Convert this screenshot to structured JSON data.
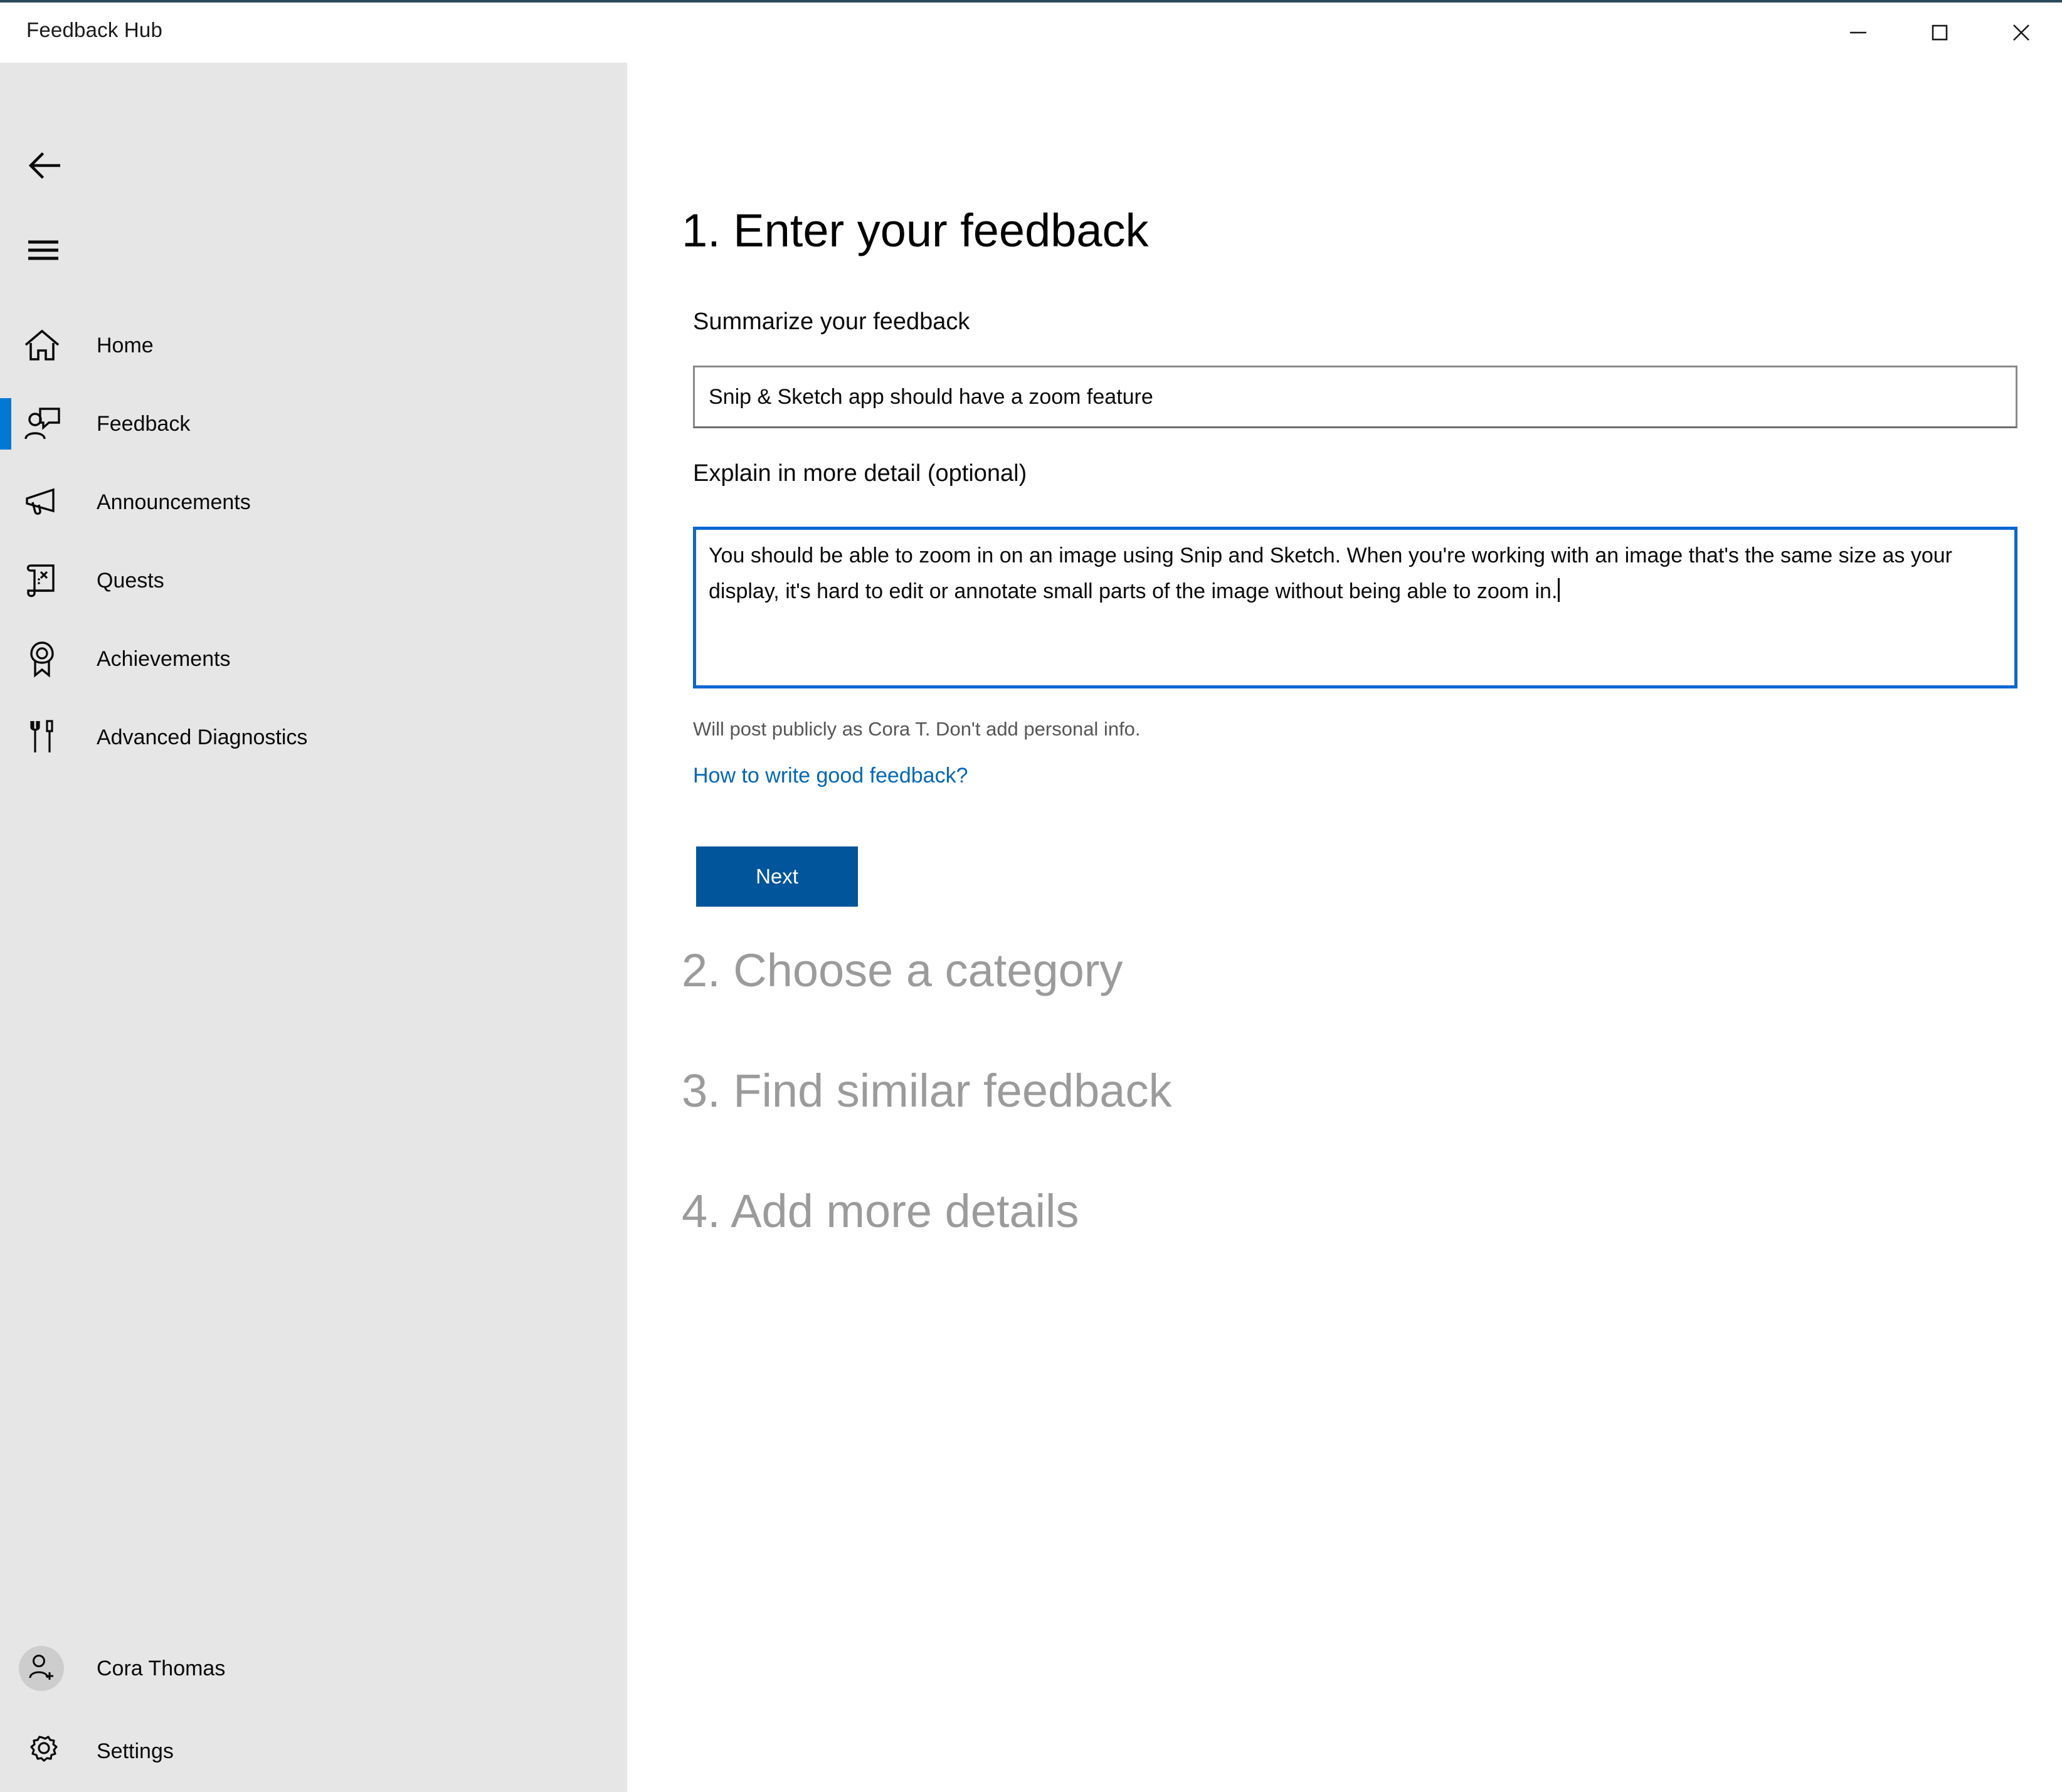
{
  "window": {
    "title": "Feedback Hub",
    "caption_buttons": [
      {
        "name": "minimize",
        "label": "Minimize"
      },
      {
        "name": "maximize",
        "label": "Maximize"
      },
      {
        "name": "close",
        "label": "Close"
      }
    ]
  },
  "sidebar": {
    "back_label": "Back",
    "menu_label": "Navigation menu",
    "items": [
      {
        "label": "Home",
        "icon": "home-icon",
        "selected": false
      },
      {
        "label": "Feedback",
        "icon": "feedback-icon",
        "selected": true
      },
      {
        "label": "Announcements",
        "icon": "megaphone-icon",
        "selected": false
      },
      {
        "label": "Quests",
        "icon": "scroll-icon",
        "selected": false
      },
      {
        "label": "Achievements",
        "icon": "award-ribbon-icon",
        "selected": false
      },
      {
        "label": "Advanced Diagnostics",
        "icon": "tools-icon",
        "selected": false
      }
    ],
    "account": {
      "name": "Cora Thomas",
      "icon": "account-add-icon"
    },
    "settings": {
      "label": "Settings",
      "icon": "gear-icon"
    }
  },
  "main": {
    "steps": [
      {
        "heading": "1. Enter your feedback",
        "state": "active"
      },
      {
        "heading": "2. Choose a category",
        "state": "disabled"
      },
      {
        "heading": "3. Find similar feedback",
        "state": "disabled"
      },
      {
        "heading": "4. Add more details",
        "state": "disabled"
      }
    ],
    "summary_field": {
      "label": "Summarize your feedback",
      "value": "Snip & Sketch app should have a zoom feature",
      "placeholder": ""
    },
    "detail_field": {
      "label": "Explain in more detail (optional)",
      "value": "You should be able to zoom in on an image using Snip and Sketch. When you're working with an image that's the same size as your display, it's hard to edit or annotate small parts of the image without being able to zoom in.",
      "placeholder": "",
      "focused": true
    },
    "disclaimer": "Will post publicly as Cora T. Don't add personal info.",
    "help_link": "How to write good feedback?",
    "next_button": "Next"
  },
  "colors": {
    "accent_selection": "#0078d4",
    "focus_border": "#0a67d2",
    "link": "#0067b8",
    "primary_button": "#00559b",
    "sidebar_bg": "#e6e6e6",
    "disabled_heading": "#9b9b9b"
  }
}
